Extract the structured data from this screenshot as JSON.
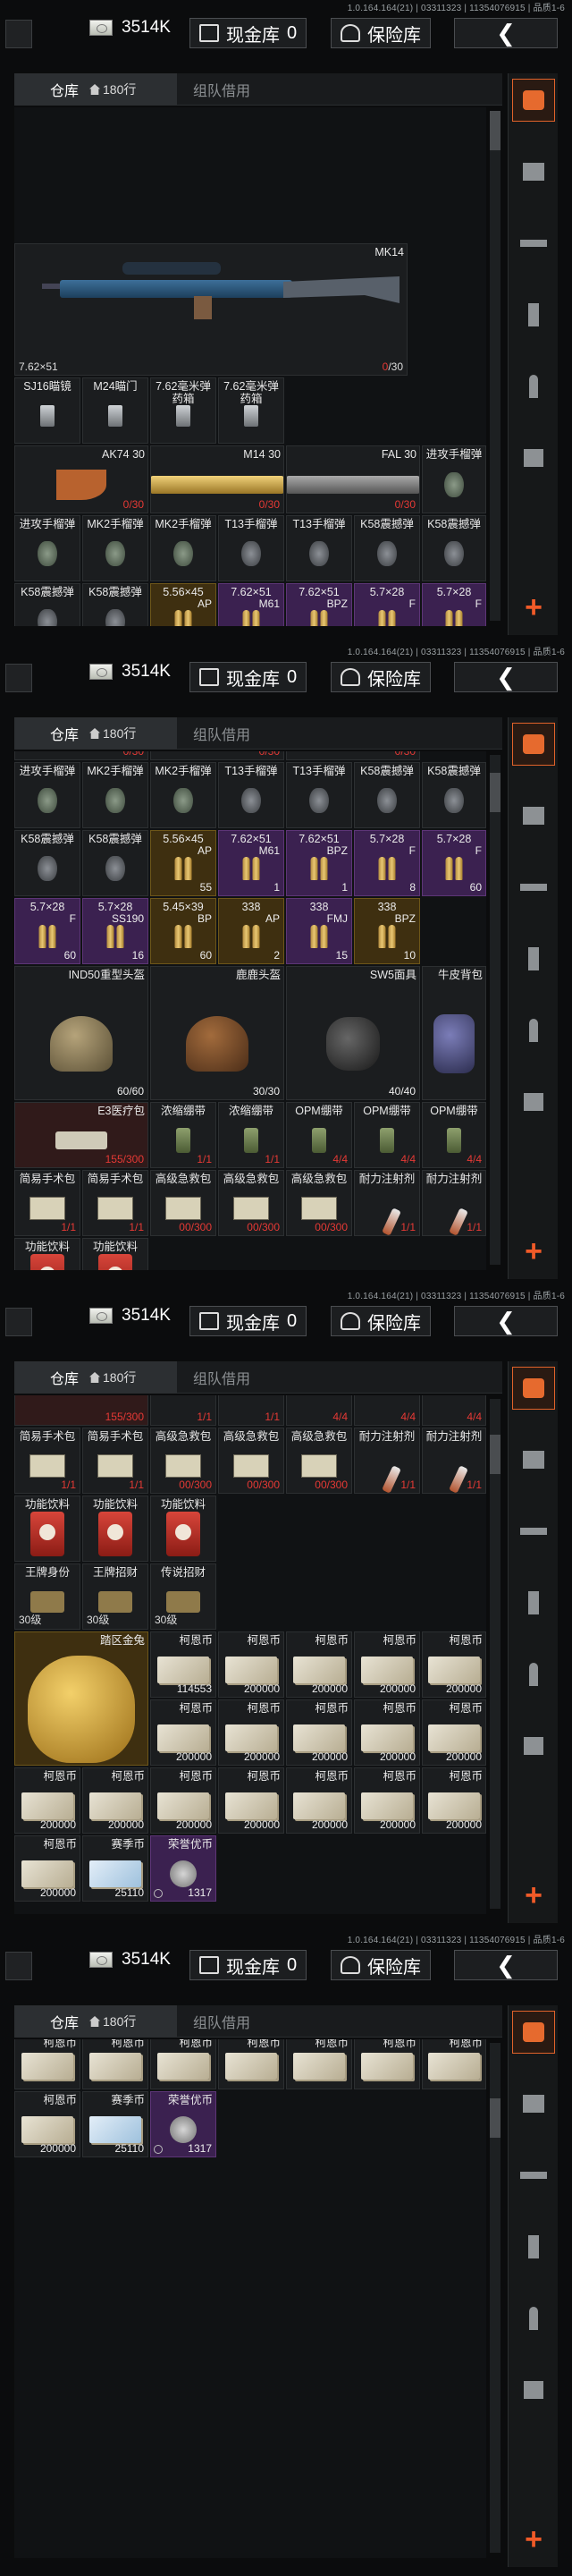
{
  "device_info": "1.0.164.164(21) | 03311323 | 11354076915 | 品质1-6",
  "cash_amount": "3514K",
  "cash_vault_label": "现金库",
  "cash_vault_count": "0",
  "safe_vault_label": "保险库",
  "tab_warehouse": "仓库",
  "tab_warehouse_count": "180行",
  "tab_team": "组队借用",
  "colors": {
    "accent": "#e0622a",
    "purple_rarity": "#3b2150",
    "gold_rarity": "#3e2f10",
    "warn_red": "#e53935"
  },
  "items": {
    "mk14": {
      "name": "MK14",
      "caliber": "7.62×51",
      "ammo_now": "0",
      "ammo_max": "/30"
    },
    "sj16": {
      "name": "SJ16瞄镜"
    },
    "m24": {
      "name": "M24瞄门"
    },
    "m762_a": {
      "name": "7.62毫米弹药箱"
    },
    "m762_b": {
      "name": "7.62毫米弹药箱"
    },
    "ak74": {
      "name": "AK74 30",
      "count": "0/30"
    },
    "m14_30": {
      "name": "M14 30",
      "count": "0/30"
    },
    "fal_30": {
      "name": "FAL 30",
      "count": "0/30"
    },
    "attack_grenade": {
      "name": "进攻手榴弹"
    },
    "mk2": {
      "name": "MK2手榴弹"
    },
    "t13": {
      "name": "T13手榴弹"
    },
    "k58": {
      "name": "K58震撼弹"
    },
    "a556": {
      "name": "5.56×45",
      "tag": "AP",
      "count": "55"
    },
    "a762m61": {
      "name": "7.62×51",
      "tag": "M61",
      "count": "1"
    },
    "a762bpz": {
      "name": "7.62×51",
      "tag": "BPZ",
      "count": "1"
    },
    "a57f": {
      "name": "5.7×28",
      "tag": "F",
      "count": "8"
    },
    "a57f2": {
      "name": "5.7×28",
      "tag": "F",
      "count": "60"
    },
    "a57ss190": {
      "name": "5.7×28",
      "tag": "SS190",
      "count": "16"
    },
    "a545bp": {
      "name": "5.45×39",
      "tag": "BP",
      "count": "60"
    },
    "a338ap": {
      "name": "338",
      "tag": "AP",
      "count": "2"
    },
    "a338fmj": {
      "name": "338",
      "tag": "FMJ",
      "count": "15"
    },
    "a338bpz": {
      "name": "338",
      "tag": "BPZ",
      "count": "10"
    },
    "ind50": {
      "name": "IND50重型头盔",
      "count": "60/60"
    },
    "deer": {
      "name": "鹿鹿头盔",
      "count": "30/30"
    },
    "sw5": {
      "name": "SW5面具",
      "count": "40/40"
    },
    "bag": {
      "name": "牛皮背包"
    },
    "e3": {
      "name": "E3医疗包",
      "count": "155/300"
    },
    "bandage": {
      "name": "浓缩绷带",
      "count": "1/1"
    },
    "opm": {
      "name": "OPM绷带",
      "count": "4/4"
    },
    "kit_simple": {
      "name": "简易手术包",
      "count": "1/1"
    },
    "kit_high": {
      "name": "高级急救包",
      "count": "00/300"
    },
    "stamina": {
      "name": "耐力注射剂",
      "count": "1/1"
    },
    "drink": {
      "name": "功能饮料"
    },
    "wang_card": {
      "name": "王牌身份",
      "tag": "30级"
    },
    "wang_card2": {
      "name": "王牌招财",
      "tag": "30级"
    },
    "legend_card": {
      "name": "传说招财",
      "tag": "30级"
    },
    "gold_rabbit": {
      "name": "踏区金兔"
    },
    "coin_label": "柯恩币",
    "coin_a": {
      "count": "114553"
    },
    "coin_b": {
      "count": "200000"
    },
    "race_coin": {
      "name": "赛季币",
      "count": "25110"
    },
    "honor": {
      "name": "荣誉优币",
      "count": "1317"
    }
  }
}
